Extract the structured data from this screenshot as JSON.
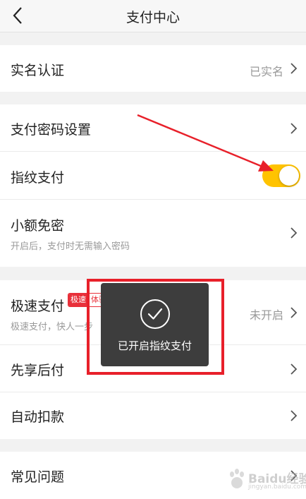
{
  "header": {
    "title": "支付中心"
  },
  "groups": {
    "identity": {
      "label": "实名认证",
      "value": "已实名"
    },
    "security": {
      "pay_password": "支付密码设置",
      "fingerprint": {
        "label": "指纹支付",
        "enabled": true
      },
      "small_free": {
        "label": "小额免密",
        "sub": "开启后，支付时无需输入密码"
      }
    },
    "payment": {
      "quick_pay": {
        "label": "极速支付",
        "badge_a": "极速",
        "badge_b": "体验",
        "sub": "极速支付，快人一步",
        "value": "未开启"
      },
      "pay_later": "先享后付",
      "auto_debit": "自动扣款"
    },
    "faq": {
      "label": "常见问题"
    }
  },
  "toast": {
    "message": "已开启指纹支付",
    "icon": "check-circle-icon"
  },
  "watermark": {
    "brand": "Baidu经验",
    "url": "jingyan.baidu.com"
  },
  "colors": {
    "toggle_on": "#ffc300",
    "annotation_red": "#e8202a",
    "badge_red": "#e8303a"
  }
}
